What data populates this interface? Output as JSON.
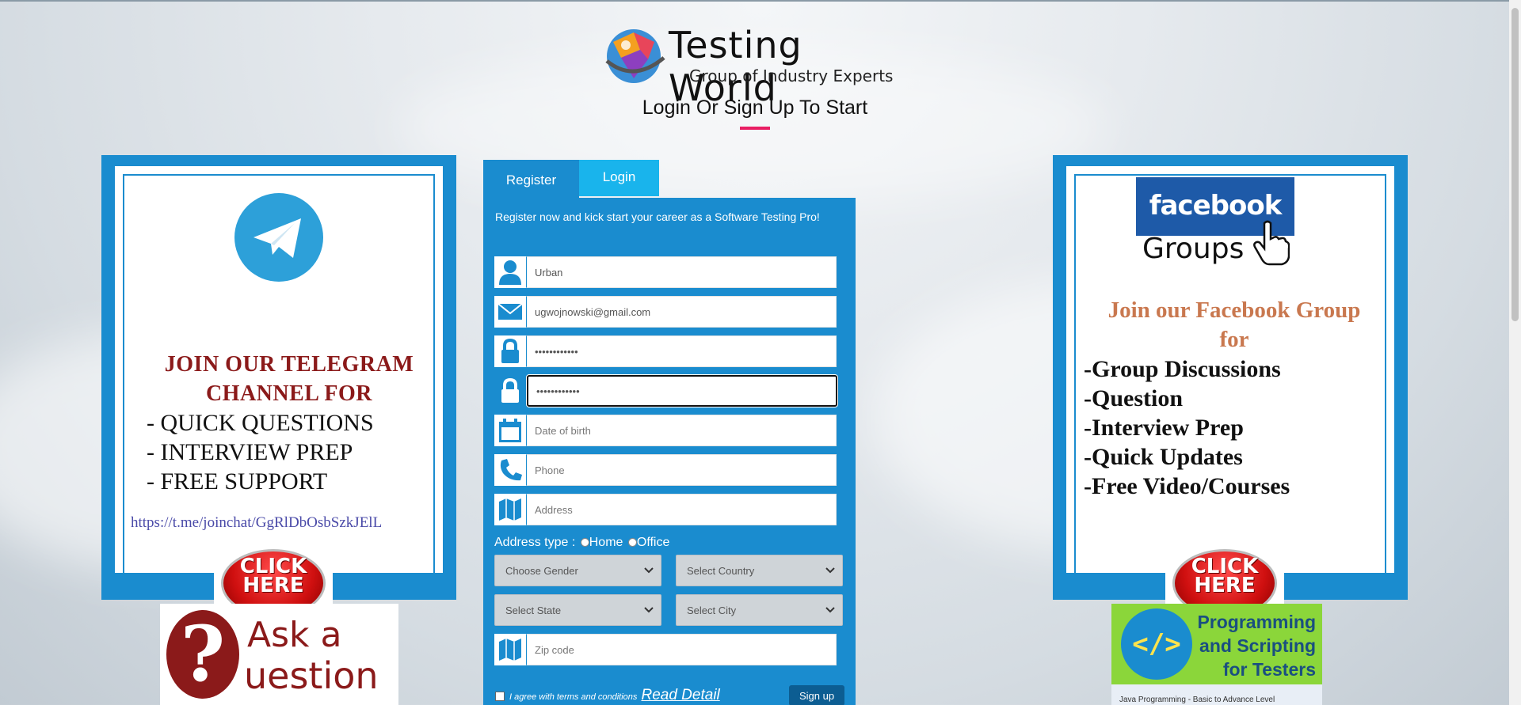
{
  "header": {
    "brand_name": "Testing World",
    "brand_tagline": "Group of Industry Experts",
    "page_title": "Login Or Sign Up To Start"
  },
  "tabs": [
    {
      "label": "Register",
      "active": true
    },
    {
      "label": "Login",
      "active": false
    }
  ],
  "form": {
    "intro": "Register now and kick start your career as a Software Testing Pro!",
    "fields": {
      "name": {
        "value": "Urban",
        "icon": "user-icon"
      },
      "email": {
        "value": "ugwojnowski@gmail.com",
        "icon": "envelope-icon"
      },
      "password": {
        "value": "••••••••••••",
        "icon": "lock-icon"
      },
      "confirm_password": {
        "value": "••••••••••••",
        "icon": "lock-icon"
      },
      "dob": {
        "placeholder": "Date of birth",
        "icon": "calendar-icon"
      },
      "phone": {
        "placeholder": "Phone",
        "icon": "phone-icon"
      },
      "address": {
        "placeholder": "Address",
        "icon": "map-icon"
      },
      "zip": {
        "placeholder": "Zip code",
        "icon": "map-icon"
      }
    },
    "address_type": {
      "label": "Address type :",
      "options": [
        "Home",
        "Office"
      ]
    },
    "selects": {
      "gender": "Choose Gender",
      "country": "Select Country",
      "state": "Select State",
      "city": "Select City"
    },
    "terms_text": "I agree with terms and conditions",
    "read_detail": "Read Detail",
    "signup_label": "Sign up"
  },
  "telegram": {
    "heading_line1": "JOIN OUR TELEGRAM",
    "heading_line2": "CHANNEL  FOR",
    "items": [
      "- QUICK QUESTIONS",
      "- INTERVIEW PREP",
      "- FREE SUPPORT"
    ],
    "link": "https://t.me/joinchat/GgRlDbOsbSzkJElL",
    "click_label_1": "CLICK",
    "click_label_2": "HERE"
  },
  "facebook": {
    "logo_word": "facebook",
    "logo_groups": "Groups",
    "heading_line1": "Join our Facebook Group",
    "heading_line2": "for",
    "items": [
      "-Group Discussions",
      "-Question",
      "-Interview Prep",
      "-Quick Updates",
      "-Free Video/Courses"
    ],
    "click_label_1": "CLICK",
    "click_label_2": "HERE"
  },
  "ask": {
    "q_glyph": "?",
    "line1": "Ask a",
    "line2": "uestion"
  },
  "programming": {
    "icon_glyph": "</>",
    "line1": "Programming",
    "line2": "and Scripting",
    "line3": "for Testers",
    "bottom": "Java Programming - Basic to Advance Level"
  },
  "colors": {
    "accent": "#1a8ccf",
    "tab_login": "#19b4ec",
    "title_underline": "#e91e63"
  }
}
